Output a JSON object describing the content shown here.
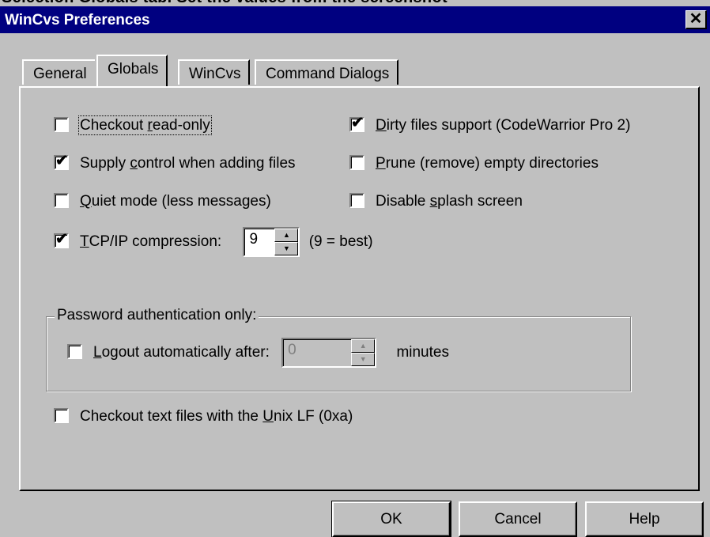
{
  "cut_header_text": "Selection Globals tab. Set the values from the screenshot",
  "window": {
    "title": "WinCvs Preferences",
    "close_glyph": "✕"
  },
  "tabs": [
    "General",
    "Globals",
    "WinCvs",
    "Command Dialogs"
  ],
  "active_tab": "Globals",
  "options": {
    "checkout_readonly": {
      "pre": "Checkout ",
      "u": "r",
      "post": "ead-only",
      "checked": false
    },
    "supply_control": {
      "pre": "Supply ",
      "u": "c",
      "post": "ontrol when adding files",
      "checked": true
    },
    "quiet_mode": {
      "pre": "",
      "u": "Q",
      "post": "uiet mode (less messages)",
      "checked": false
    },
    "tcpip": {
      "pre": "",
      "u": "T",
      "post": "CP/IP compression:",
      "checked": true
    },
    "dirty_files": {
      "pre": "",
      "u": "D",
      "post": "irty files support (CodeWarrior Pro 2)",
      "checked": true
    },
    "prune": {
      "pre": "",
      "u": "P",
      "post": "rune (remove) empty directories",
      "checked": false
    },
    "splash": {
      "pre": "Disable ",
      "u": "s",
      "post": "plash screen",
      "checked": false
    },
    "unix_lf": {
      "pre": "Checkout text files with the ",
      "u": "U",
      "post": "nix LF (0xa)",
      "checked": false
    }
  },
  "compression": {
    "value": "9",
    "hint": "(9 = best)"
  },
  "password_group": {
    "legend": "Password authentication only:",
    "logout": {
      "pre": "",
      "u": "L",
      "post": "ogout automatically after:",
      "checked": false
    },
    "minutes_value": "0",
    "minutes_label": "minutes"
  },
  "buttons": {
    "ok": "OK",
    "cancel": "Cancel",
    "help": "Help"
  },
  "glyphs": {
    "check": "✔",
    "up": "▲",
    "down": "▼"
  }
}
